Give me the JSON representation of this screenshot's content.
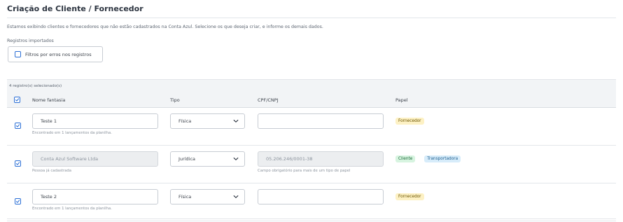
{
  "page": {
    "title": "Criação de Cliente / Fornecedor",
    "description": "Estamos exibindo clientes e fornecedores que não estão cadastrados na Conta Azul. Selecione os que deseja criar, e informe os demais dados.",
    "imported_label": "Registros importados",
    "filter_button_label": "Filtros por erros nos registros",
    "selection_count": "4 registro(s) selecionado(s)"
  },
  "table": {
    "headers": {
      "name": "Nome fantasia",
      "type": "Tipo",
      "doc": "CPF/CNPJ",
      "role": "Papel"
    },
    "rows": [
      {
        "checked": true,
        "name": "Teste 1",
        "name_disabled": false,
        "name_help": "Encontrado em 1 lançamentos da planilha.",
        "type": "Física",
        "doc": "",
        "doc_disabled": false,
        "doc_help": "",
        "roles": [
          "Fornecedor"
        ]
      },
      {
        "checked": true,
        "name": "Conta Azul Software Ltda",
        "name_disabled": true,
        "name_help": "Pessoa já cadastrada",
        "type": "Jurídica",
        "doc": "05.206.246/0001-38",
        "doc_disabled": true,
        "doc_help": "Campo obrigatório para mais de um tipo de papel",
        "roles": [
          "Cliente",
          "Transportadora"
        ]
      },
      {
        "checked": true,
        "name": "Teste 2",
        "name_disabled": false,
        "name_help": "Encontrado em 1 lançamentos da planilha.",
        "type": "Física",
        "doc": "",
        "doc_disabled": false,
        "doc_help": "",
        "roles": [
          "Fornecedor"
        ]
      }
    ]
  },
  "colors": {
    "accent": "#2b6fd6",
    "fornecedor_bg": "#fdf1c4",
    "cliente_bg": "#d7f4e0",
    "transportadora_bg": "#d7ecfa"
  },
  "icons": {
    "checkbox": "check-icon",
    "select": "chevron-down-icon"
  }
}
